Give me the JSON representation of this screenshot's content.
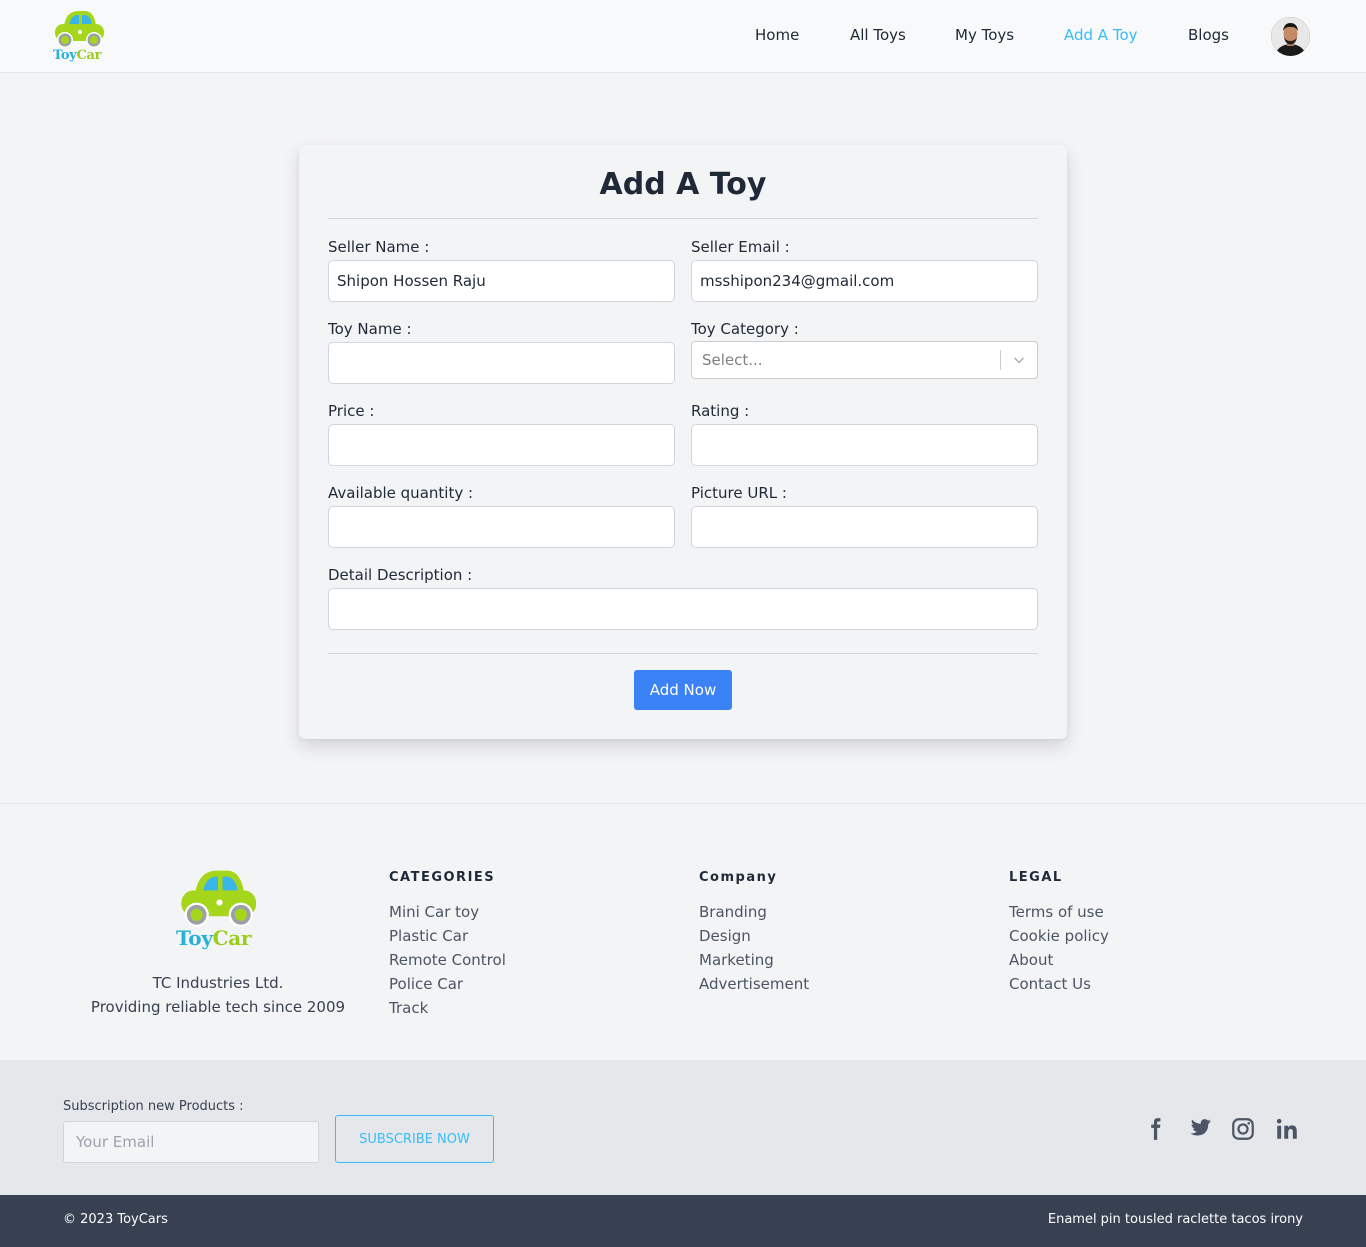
{
  "brand": {
    "logo_word_1": "Toy",
    "logo_word_2": "Car",
    "primary_color": "#3b82f6",
    "accent_color": "#38bdf8",
    "lime_color": "#9acd1b"
  },
  "nav": {
    "items": [
      {
        "label": "Home"
      },
      {
        "label": "All Toys"
      },
      {
        "label": "My Toys"
      },
      {
        "label": "Add A Toy",
        "active": true
      },
      {
        "label": "Blogs"
      }
    ],
    "avatar_icon": "user-avatar"
  },
  "form": {
    "title": "Add A Toy",
    "seller_name": {
      "label": "Seller Name :",
      "value": "Shipon Hossen Raju"
    },
    "seller_email": {
      "label": "Seller Email :",
      "value": "msshipon234@gmail.com"
    },
    "toy_name": {
      "label": "Toy Name :",
      "value": ""
    },
    "toy_category": {
      "label": "Toy Category :",
      "placeholder": "Select..."
    },
    "price": {
      "label": "Price :",
      "value": ""
    },
    "rating": {
      "label": "Rating :",
      "value": ""
    },
    "quantity": {
      "label": "Available quantity :",
      "value": ""
    },
    "picture_url": {
      "label": "Picture URL :",
      "value": ""
    },
    "description": {
      "label": "Detail Description :",
      "value": ""
    },
    "submit_label": "Add Now"
  },
  "footer": {
    "company_name": "TC Industries Ltd.",
    "company_tagline": "Providing reliable tech since 2009",
    "columns": [
      {
        "title": "CATEGORIES",
        "links": [
          "Mini Car toy",
          "Plastic Car",
          "Remote Control",
          "Police Car",
          "Track"
        ]
      },
      {
        "title": "Company",
        "links": [
          "Branding",
          "Design",
          "Marketing",
          "Advertisement"
        ]
      },
      {
        "title": "LEGAL",
        "links": [
          "Terms of use",
          "Cookie policy",
          "About",
          "Contact Us"
        ]
      }
    ],
    "subscribe": {
      "label": "Subscription new Products :",
      "placeholder": "Your Email",
      "button_label": "SUBSCRIBE NOW"
    },
    "social_icons": [
      "facebook-icon",
      "twitter-icon",
      "instagram-icon",
      "linkedin-icon"
    ],
    "copyright": "© 2023 ToyCars",
    "tagline": "Enamel pin tousled raclette tacos irony"
  }
}
